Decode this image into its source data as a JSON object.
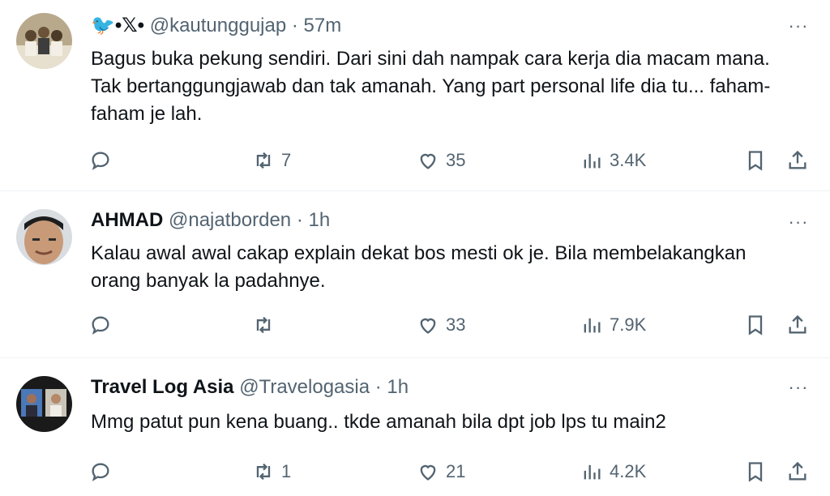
{
  "tweets": [
    {
      "display_name": "🐦•𝕏•",
      "handle": "@kautunggujap",
      "time": "· 57m",
      "text": "Bagus buka pekung sendiri. Dari sini dah nampak cara kerja dia macam mana. Tak bertanggungjawab dan tak amanah. Yang part personal life dia tu... faham-faham je lah.",
      "replies": "",
      "retweets": "7",
      "likes": "35",
      "views": "3.4K"
    },
    {
      "display_name": "AHMAD",
      "handle": "@najatborden",
      "time": "· 1h",
      "text": "Kalau awal awal cakap explain dekat bos mesti ok je. Bila membelakangkan orang banyak la padahnye.",
      "replies": "",
      "retweets": "",
      "likes": "33",
      "views": "7.9K"
    },
    {
      "display_name": "Travel Log Asia",
      "handle": "@Travelogasia",
      "time": "· 1h",
      "text": "Mmg patut pun kena buang.. tkde amanah bila dpt job lps tu main2",
      "replies": "",
      "retweets": "1",
      "likes": "21",
      "views": "4.2K"
    }
  ],
  "more_label": "···",
  "icons": {
    "reply": "reply-icon",
    "retweet": "retweet-icon",
    "like": "heart-icon",
    "views": "views-icon",
    "bookmark": "bookmark-icon",
    "share": "share-icon"
  },
  "colors": {
    "text": "#0f1419",
    "muted": "#536471",
    "divider": "#eff3f4"
  }
}
